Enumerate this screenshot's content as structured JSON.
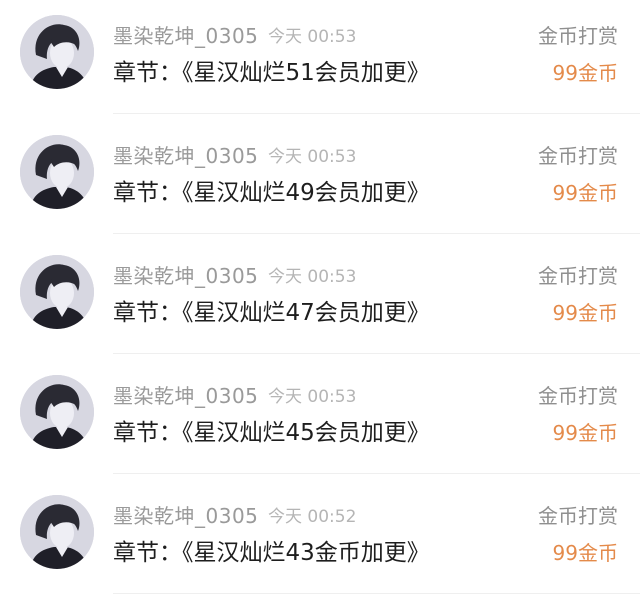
{
  "records": [
    {
      "username": "墨染乾坤_0305",
      "time": "今天 00:53",
      "gift_type": "金币打赏",
      "chapter": "章节：《星汉灿烂51会员加更》",
      "amount": "99金币"
    },
    {
      "username": "墨染乾坤_0305",
      "time": "今天 00:53",
      "gift_type": "金币打赏",
      "chapter": "章节：《星汉灿烂49会员加更》",
      "amount": "99金币"
    },
    {
      "username": "墨染乾坤_0305",
      "time": "今天 00:53",
      "gift_type": "金币打赏",
      "chapter": "章节：《星汉灿烂47会员加更》",
      "amount": "99金币"
    },
    {
      "username": "墨染乾坤_0305",
      "time": "今天 00:53",
      "gift_type": "金币打赏",
      "chapter": "章节：《星汉灿烂45会员加更》",
      "amount": "99金币"
    },
    {
      "username": "墨染乾坤_0305",
      "time": "今天 00:52",
      "gift_type": "金币打赏",
      "chapter": "章节：《星汉灿烂43金币加更》",
      "amount": "99金币"
    }
  ],
  "colors": {
    "amount": "#e48a4a",
    "username": "#9a9a9a",
    "chapter": "#1e1e1e"
  },
  "icons": {
    "avatar": "user-avatar-photo"
  }
}
